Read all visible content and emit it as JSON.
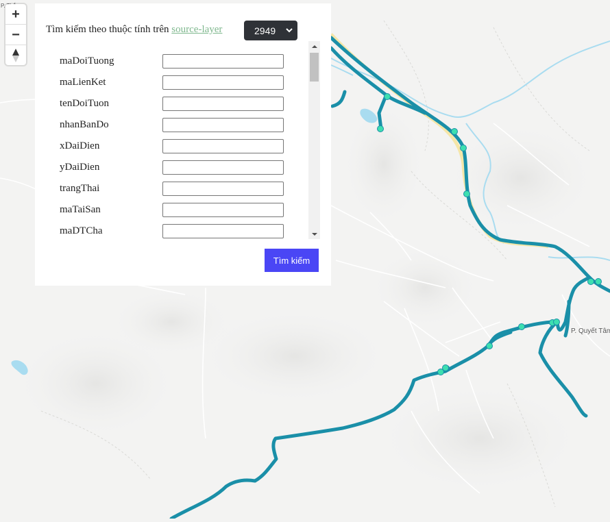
{
  "map": {
    "zoom_in_label": "+",
    "zoom_out_label": "−",
    "compass_icon": "compass-icon",
    "colors": {
      "background": "#f3f3f2",
      "water": "#a9dcf0",
      "road": "#ffffff",
      "network_line": "#1a8fa8",
      "node": "#3ddfb0",
      "highlight": "#f5e6a8"
    },
    "places": [
      {
        "name": "P. Quyết Tâm"
      },
      {
        "name": "P. Thắng"
      }
    ]
  },
  "panel": {
    "title_prefix": "Tìm kiếm theo thuộc tính trên",
    "title_link": "source-layer",
    "layer_value": "2949",
    "fields": [
      {
        "label": "maDoiTuong",
        "value": ""
      },
      {
        "label": "maLienKet",
        "value": ""
      },
      {
        "label": "tenDoiTuon",
        "value": ""
      },
      {
        "label": "nhanBanDo",
        "value": ""
      },
      {
        "label": "xDaiDien",
        "value": ""
      },
      {
        "label": "yDaiDien",
        "value": ""
      },
      {
        "label": "trangThai",
        "value": ""
      },
      {
        "label": "maTaiSan",
        "value": ""
      },
      {
        "label": "maDTCha",
        "value": ""
      }
    ],
    "search_button": "Tìm kiếm"
  }
}
